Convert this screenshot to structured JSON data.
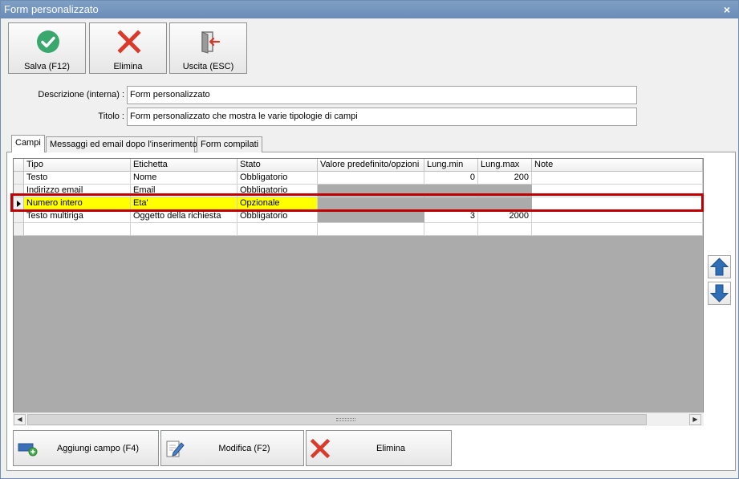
{
  "window": {
    "title": "Form personalizzato",
    "close_glyph": "×"
  },
  "toolbar": [
    {
      "label": "Salva (F12)",
      "icon": "check-circle-icon",
      "color": "#3aa76d"
    },
    {
      "label": "Elimina",
      "icon": "red-x-icon",
      "color": "#d93a2b"
    },
    {
      "label": "Uscita (ESC)",
      "icon": "exit-door-icon",
      "color": "#c0392b"
    }
  ],
  "form": {
    "descrizione_label": "Descrizione (interna) :",
    "descrizione_value": "Form personalizzato",
    "titolo_label": "Titolo :",
    "titolo_value": "Form personalizzato che mostra le varie tipologie di campi"
  },
  "tabs": [
    {
      "label": "Campi",
      "active": true
    },
    {
      "label": "Messaggi ed email dopo l'inserimento",
      "active": false
    },
    {
      "label": "Form compilati",
      "active": false
    }
  ],
  "grid": {
    "columns": [
      "Tipo",
      "Etichetta",
      "Stato",
      "Valore predefinito/opzioni",
      "Lung.min",
      "Lung.max",
      "Note"
    ],
    "rows": [
      {
        "tipo": "Testo",
        "etichetta": "Nome",
        "stato": "Obbligatorio",
        "valore": "",
        "lung_min": "0",
        "lung_max": "200",
        "note": ""
      },
      {
        "tipo": "Indirizzo email",
        "etichetta": "Email",
        "stato": "Obbligatorio",
        "valore": "",
        "lung_min": "",
        "lung_max": "",
        "note": ""
      },
      {
        "tipo": "Numero intero",
        "etichetta": "Eta'",
        "stato": "Opzionale",
        "valore": "",
        "lung_min": "",
        "lung_max": "",
        "note": ""
      },
      {
        "tipo": "Testo multiriga",
        "etichetta": "Oggetto della richiesta",
        "stato": "Obbligatorio",
        "valore": "",
        "lung_min": "3",
        "lung_max": "2000",
        "note": ""
      }
    ],
    "selected_row": 2,
    "highlight_color": "#c00000",
    "selected_fill": "#ffff00"
  },
  "scrollbar": {
    "left_glyph": "◀",
    "right_glyph": "▶"
  },
  "side_buttons": [
    {
      "icon": "arrow-up-icon",
      "color": "#2f6db5"
    },
    {
      "icon": "arrow-down-icon",
      "color": "#2f6db5"
    }
  ],
  "bottom_buttons": [
    {
      "label": "Aggiungi campo (F4)",
      "icon": "add-field-icon"
    },
    {
      "label": "Modifica (F2)",
      "icon": "edit-pencil-icon"
    },
    {
      "label": "Elimina",
      "icon": "red-x-icon"
    }
  ]
}
